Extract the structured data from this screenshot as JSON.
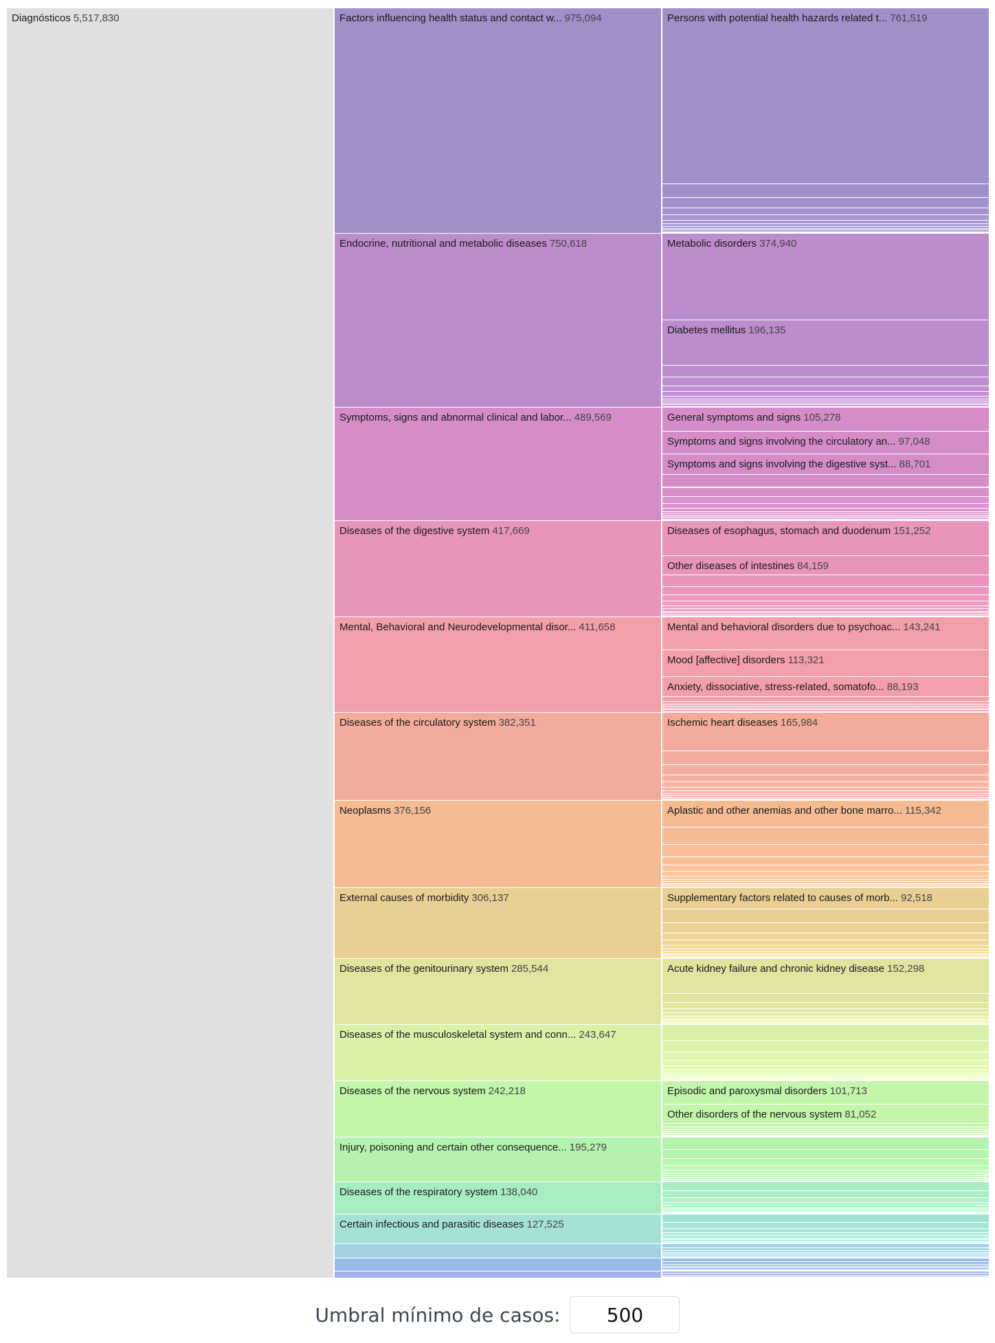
{
  "chart_data": {
    "type": "icicle",
    "root": {
      "label": "Diagnósticos",
      "value": "5,517,830",
      "color": "#e0e0e0"
    },
    "categories": [
      {
        "label": "Factors influencing health status and contact w...",
        "value": 975094,
        "value_text": "975,094",
        "color": "#a18fca",
        "children": [
          {
            "label": "Persons with potential health hazards related t...",
            "value": 761519,
            "value_text": "761,519"
          }
        ]
      },
      {
        "label": "Endocrine, nutritional and metabolic diseases",
        "value": 750618,
        "value_text": "750,618",
        "color": "#bc8ccd",
        "children": [
          {
            "label": "Metabolic disorders",
            "value": 374940,
            "value_text": "374,940"
          },
          {
            "label": "Diabetes mellitus",
            "value": 196135,
            "value_text": "196,135"
          }
        ]
      },
      {
        "label": "Symptoms, signs and abnormal clinical and labor...",
        "value": 489569,
        "value_text": "489,569",
        "color": "#d48dc8",
        "children": [
          {
            "label": "General symptoms and signs",
            "value": 105278,
            "value_text": "105,278"
          },
          {
            "label": "Symptoms and signs involving the circulatory an...",
            "value": 97048,
            "value_text": "97,048"
          },
          {
            "label": "Symptoms and signs involving the digestive syst...",
            "value": 88701,
            "value_text": "88,701"
          }
        ]
      },
      {
        "label": "Diseases of the digestive system",
        "value": 417669,
        "value_text": "417,669",
        "color": "#e894bb",
        "children": [
          {
            "label": "Diseases of esophagus, stomach and duodenum",
            "value": 151252,
            "value_text": "151,252"
          },
          {
            "label": "Other diseases of intestines",
            "value": 84159,
            "value_text": "84,159"
          }
        ]
      },
      {
        "label": "Mental, Behavioral and Neurodevelopmental disor...",
        "value": 411658,
        "value_text": "411,658",
        "color": "#f39faa",
        "children": [
          {
            "label": "Mental and behavioral disorders due to psychoac...",
            "value": 143241,
            "value_text": "143,241"
          },
          {
            "label": "Mood [affective] disorders",
            "value": 113321,
            "value_text": "113,321"
          },
          {
            "label": "Anxiety, dissociative, stress-related, somatofo...",
            "value": 88193,
            "value_text": "88,193"
          }
        ]
      },
      {
        "label": "Diseases of the circulatory system",
        "value": 382351,
        "value_text": "382,351",
        "color": "#f3ab9d",
        "children": [
          {
            "label": "Ischemic heart diseases",
            "value": 165984,
            "value_text": "165,984"
          }
        ]
      },
      {
        "label": "Neoplasms",
        "value": 376156,
        "value_text": "376,156",
        "color": "#f5bb93",
        "children": [
          {
            "label": "Aplastic and other anemias and other bone marro...",
            "value": 115342,
            "value_text": "115,342"
          }
        ]
      },
      {
        "label": "External causes of morbidity",
        "value": 306137,
        "value_text": "306,137",
        "color": "#e9cf94",
        "children": [
          {
            "label": "Supplementary factors related to causes of morb...",
            "value": 92518,
            "value_text": "92,518"
          }
        ]
      },
      {
        "label": "Diseases of the genitourinary system",
        "value": 285544,
        "value_text": "285,544",
        "color": "#e0e49e",
        "children": [
          {
            "label": "Acute kidney failure and chronic kidney disease",
            "value": 152298,
            "value_text": "152,298"
          }
        ]
      },
      {
        "label": "Diseases of the musculoskeletal system and conn...",
        "value": 243647,
        "value_text": "243,647",
        "color": "#d8f2a8",
        "children": []
      },
      {
        "label": "Diseases of the nervous system",
        "value": 242218,
        "value_text": "242,218",
        "color": "#c3f5aa",
        "children": [
          {
            "label": "Episodic and paroxysmal disorders",
            "value": 101713,
            "value_text": "101,713"
          },
          {
            "label": "Other disorders of the nervous system",
            "value": 81052,
            "value_text": "81,052"
          }
        ]
      },
      {
        "label": "Injury, poisoning and certain other consequence...",
        "value": 195279,
        "value_text": "195,279",
        "color": "#b3f3ad",
        "children": []
      },
      {
        "label": "Diseases of the respiratory system",
        "value": 138040,
        "value_text": "138,040",
        "color": "#a8ecc2",
        "children": []
      },
      {
        "label": "Certain infectious and parasitic diseases",
        "value": 127525,
        "value_text": "127,525",
        "color": "#a5e2d5",
        "children": []
      },
      {
        "label": "",
        "value": 62000,
        "value_text": "",
        "color": "#a2d3e5",
        "children": []
      },
      {
        "label": "",
        "value": 58000,
        "value_text": "",
        "color": "#97bde6",
        "children": []
      },
      {
        "label": "",
        "value": 29000,
        "value_text": "",
        "color": "#a5b2ea",
        "children": []
      }
    ]
  },
  "controls": {
    "threshold_label": "Umbral mínimo de casos:",
    "threshold_value": "500"
  }
}
